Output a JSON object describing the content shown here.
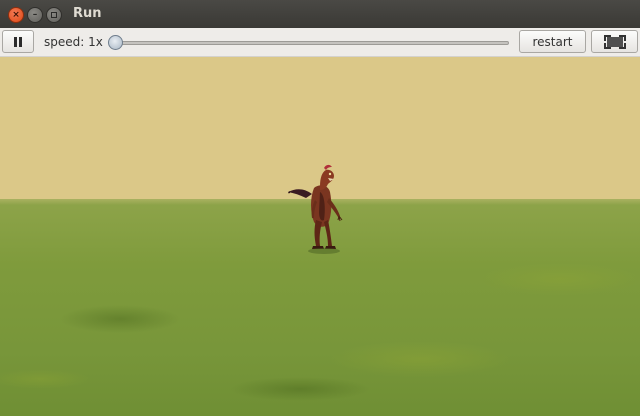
{
  "window": {
    "title": "Run",
    "controls": [
      "close-icon",
      "minimize-icon",
      "maximize-icon"
    ]
  },
  "toolbar": {
    "pause_icon": "pause-icon",
    "speed_label": "speed: 1x",
    "speed_slider_value": 0.0,
    "restart_label": "restart",
    "fullscreen_icon": "fullscreen-icon"
  },
  "scene": {
    "sky_color": "#dbc888",
    "ground_color": "#7f9b3c",
    "subject": "raptor-creature"
  }
}
